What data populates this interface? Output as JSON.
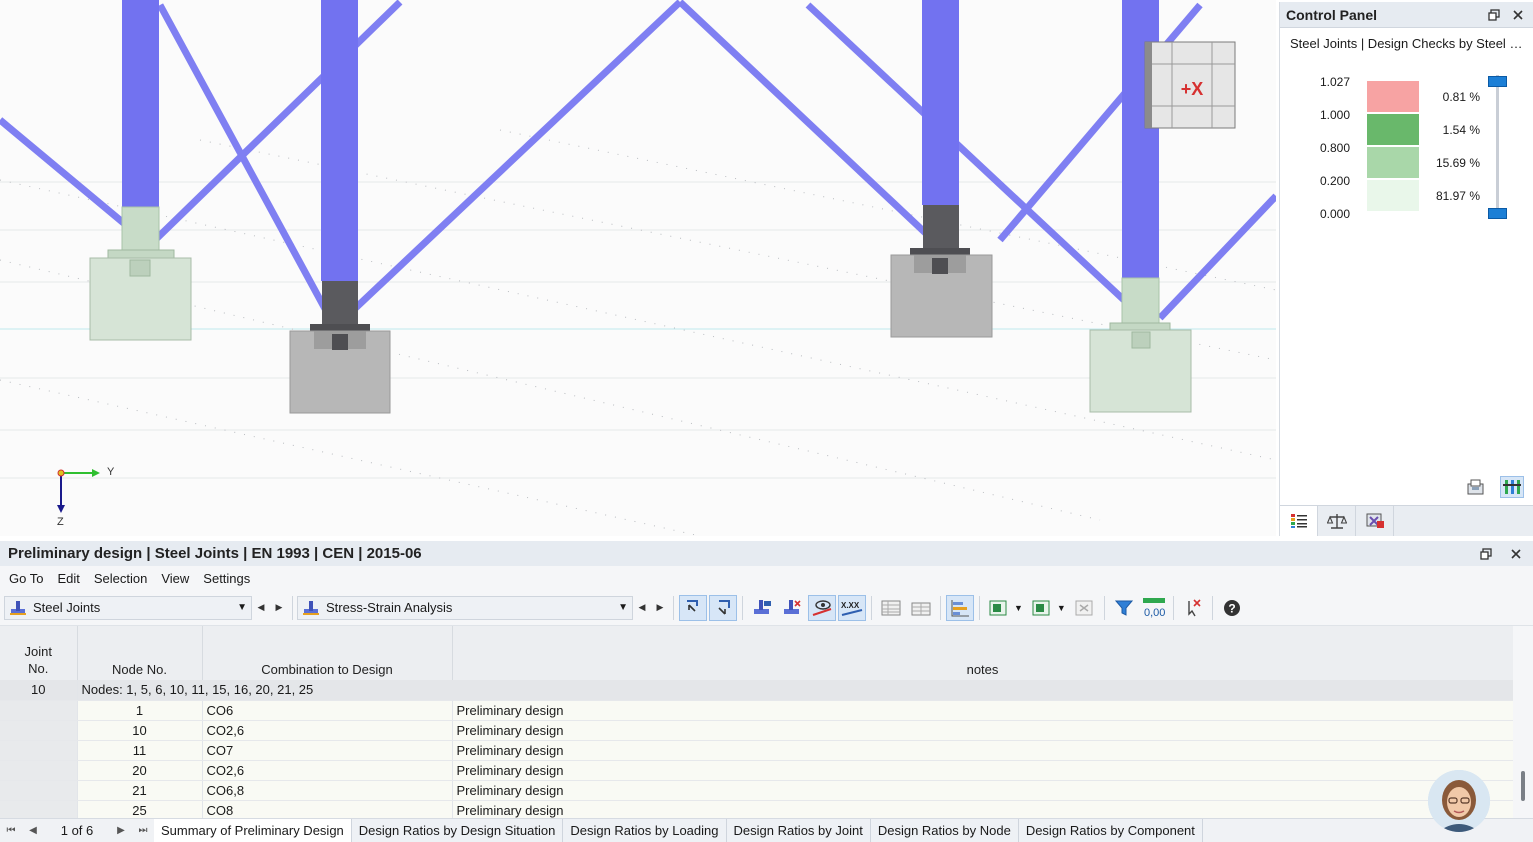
{
  "viewport": {
    "axis_y": "Y",
    "axis_z": "Z",
    "view_cube_label": "+X"
  },
  "control_panel": {
    "title": "Control Panel",
    "subtitle": "Steel Joints | Design Checks by Steel J...",
    "legend": {
      "values": [
        "1.027",
        "1.000",
        "0.800",
        "0.200",
        "0.000"
      ],
      "bands": [
        {
          "color": "#f7a3a3",
          "percent": "0.81 %"
        },
        {
          "color": "#69b86b",
          "percent": "1.54 %"
        },
        {
          "color": "#a9d7a9",
          "percent": "15.69 %"
        },
        {
          "color": "#e9f7ea",
          "percent": "81.97 %"
        }
      ]
    }
  },
  "bottom_panel": {
    "title": "Preliminary design | Steel Joints | EN 1993 | CEN | 2015-06",
    "menu": [
      "Go To",
      "Edit",
      "Selection",
      "View",
      "Settings"
    ],
    "toolbar": {
      "object_dropdown": "Steel Joints",
      "analysis_dropdown": "Stress-Strain Analysis",
      "value_display": "0,00",
      "xxx_label": "X.XX"
    },
    "table": {
      "headers": {
        "joint_no_1": "Joint",
        "joint_no_2": "No.",
        "node_no": "Node No.",
        "combination": "Combination to Design",
        "notes": "notes"
      },
      "group": {
        "joint": "10",
        "nodes": "Nodes: 1, 5, 6, 10, 11, 15, 16, 20, 21, 25"
      },
      "rows": [
        {
          "node": "1",
          "combo": "CO6",
          "note": "Preliminary design"
        },
        {
          "node": "10",
          "combo": "CO2,6",
          "note": "Preliminary design"
        },
        {
          "node": "11",
          "combo": "CO7",
          "note": "Preliminary design"
        },
        {
          "node": "20",
          "combo": "CO2,6",
          "note": "Preliminary design"
        },
        {
          "node": "21",
          "combo": "CO6,8",
          "note": "Preliminary design"
        },
        {
          "node": "25",
          "combo": "CO8",
          "note": "Preliminary design"
        }
      ]
    },
    "pager": {
      "page": "1 of 6"
    },
    "tabs": [
      "Summary of Preliminary Design",
      "Design Ratios by Design Situation",
      "Design Ratios by Loading",
      "Design Ratios by Joint",
      "Design Ratios by Node",
      "Design Ratios by Component"
    ]
  }
}
